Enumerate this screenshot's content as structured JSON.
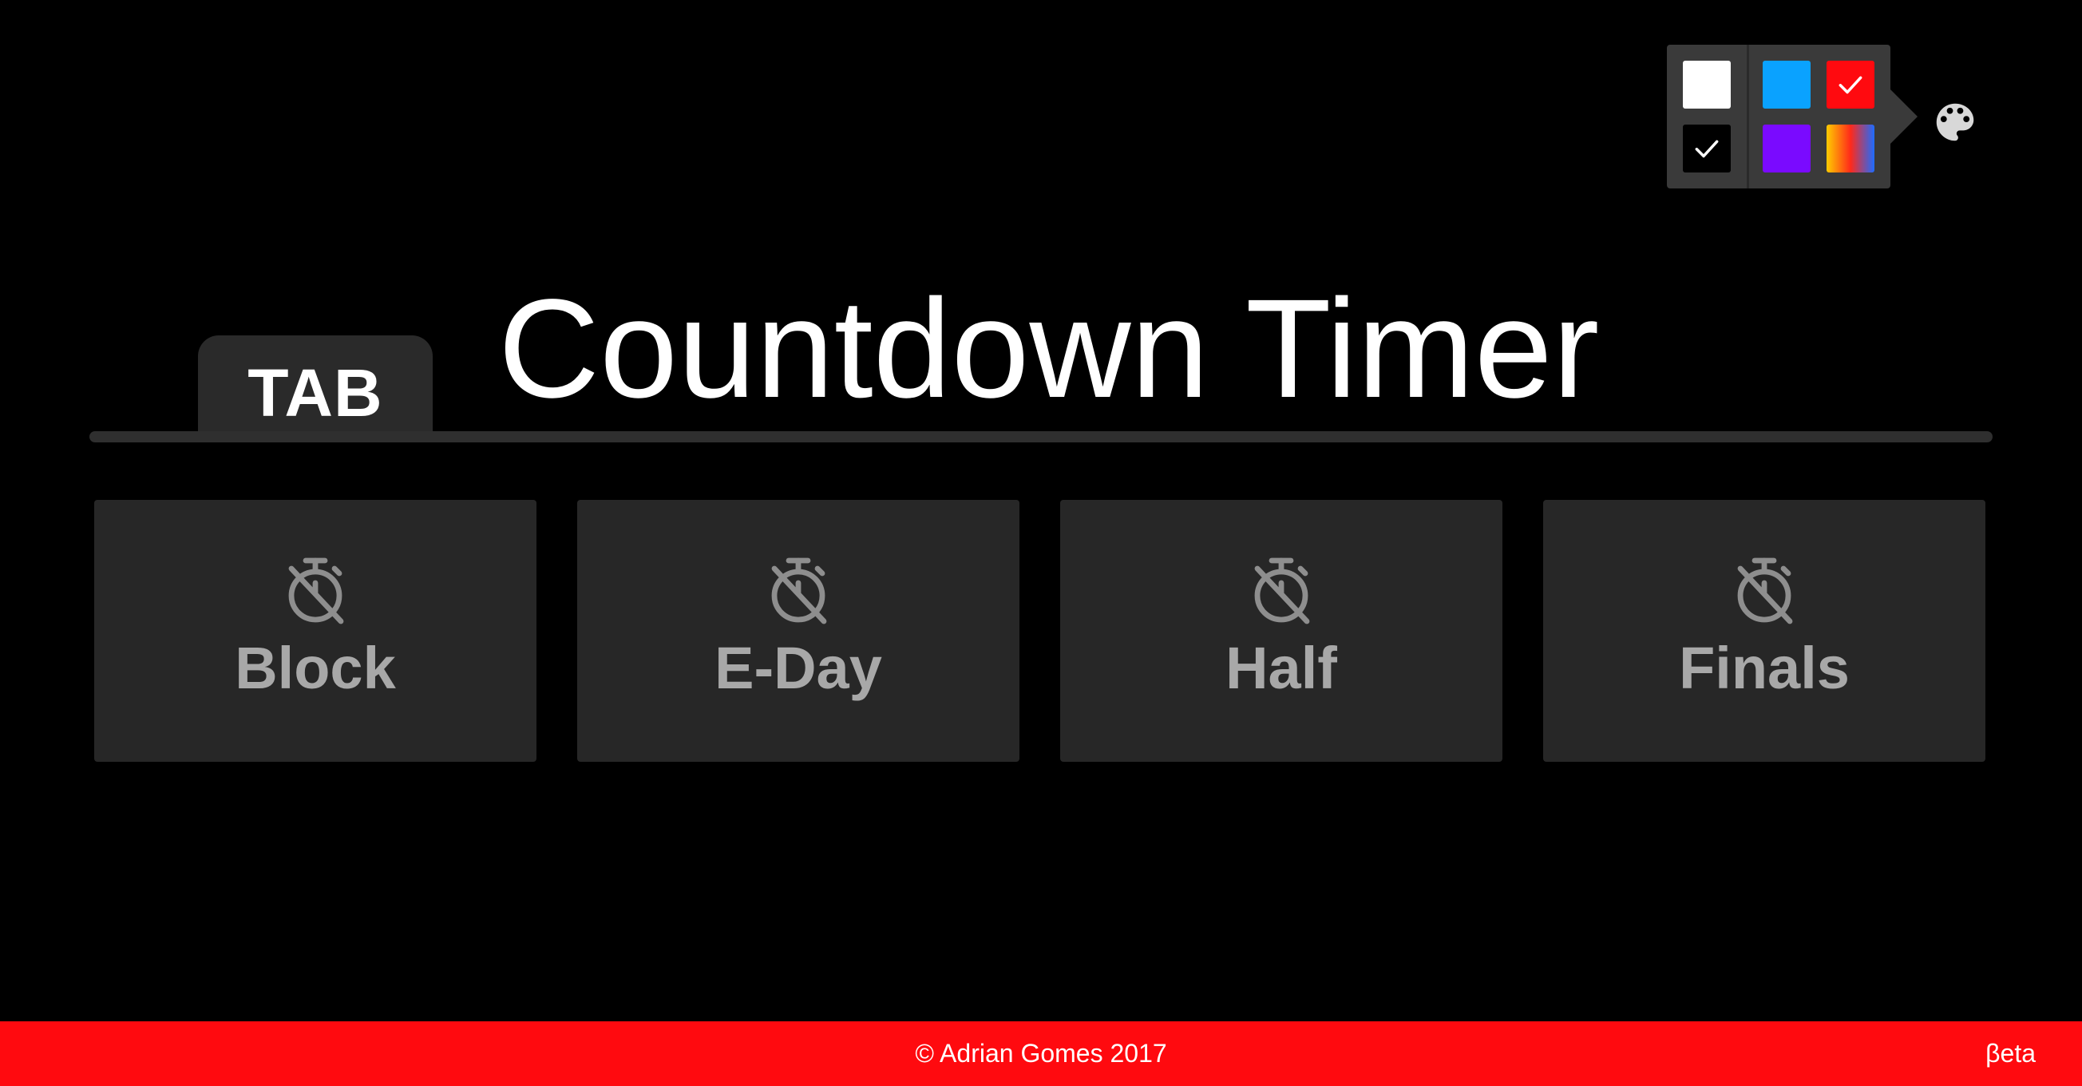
{
  "header": {
    "tab_label": "TAB",
    "title": "Countdown Timer"
  },
  "theme_picker": {
    "icon": "palette-icon",
    "swatches": [
      {
        "name": "white",
        "color": "#ffffff",
        "selected": false
      },
      {
        "name": "black",
        "color": "#000000",
        "selected": true
      },
      {
        "name": "blue",
        "color": "#0aa2ff",
        "selected": false
      },
      {
        "name": "red",
        "color": "#ff0a0f",
        "selected": true
      },
      {
        "name": "purple",
        "color": "#7a0aff",
        "selected": false
      },
      {
        "name": "gradient",
        "colors": [
          "#ffcc00",
          "#ff2a1a",
          "#1e6bff"
        ],
        "selected": false
      }
    ]
  },
  "cards": [
    {
      "label": "Block",
      "icon": "timer-off-icon"
    },
    {
      "label": "E-Day",
      "icon": "timer-off-icon"
    },
    {
      "label": "Half",
      "icon": "timer-off-icon"
    },
    {
      "label": "Finals",
      "icon": "timer-off-icon"
    }
  ],
  "footer": {
    "copyright": "© Adrian Gomes 2017",
    "beta": "βeta"
  },
  "colors": {
    "background": "#000000",
    "accent": "#ff0a0f",
    "card": "#272727",
    "card_text": "#a8a8a8"
  }
}
